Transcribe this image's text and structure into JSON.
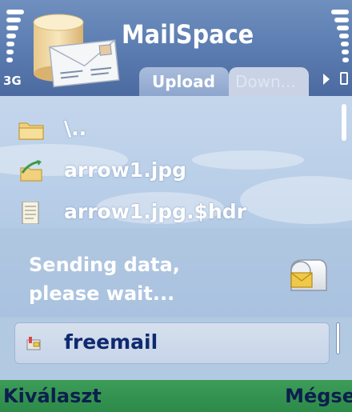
{
  "status": {
    "network_label": "3G"
  },
  "header": {
    "title": "MailSpace",
    "tabs": [
      {
        "label": "Upload",
        "active": true
      },
      {
        "label": "Down...",
        "active": false
      }
    ]
  },
  "file_list": {
    "items": [
      {
        "label": "\\..",
        "icon": "folder-icon"
      },
      {
        "label": "arrow1.jpg",
        "icon": "image-file-icon"
      },
      {
        "label": "arrow1.jpg.$hdr",
        "icon": "text-file-icon"
      }
    ]
  },
  "wait_note": {
    "line1": "Sending data,",
    "line2": "please wait...",
    "icon": "mailbox-icon",
    "selection": {
      "label": "freemail",
      "icon": "mailbox-small-icon"
    }
  },
  "softkeys": {
    "left": "Kiválaszt",
    "right": "Mégse"
  },
  "colors": {
    "header_bg": "#5a7bb0",
    "list_bg": "#c4d6ec",
    "popup_bg": "#b2c9e2",
    "softkey_bg": "#3c9c58",
    "softkey_text": "#0b1f4d",
    "selected_text": "#0f2a6e"
  }
}
